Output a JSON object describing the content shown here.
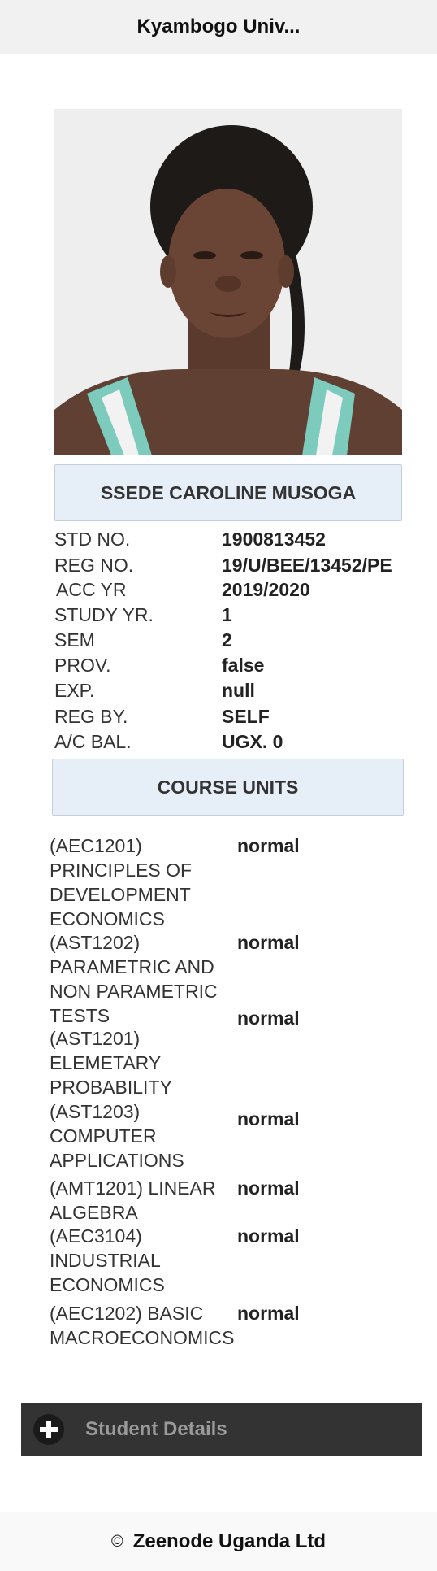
{
  "header": {
    "title": "Kyambogo Univ..."
  },
  "student": {
    "name": "SSEDE CAROLINE MUSOGA",
    "fields": [
      {
        "label": "STD NO.",
        "value": "1900813452"
      },
      {
        "label": "REG NO.",
        "value": "19/U/BEE/13452/PE"
      },
      {
        "label": "ACC YR",
        "value": "2019/2020"
      },
      {
        "label": "STUDY YR.",
        "value": "1"
      },
      {
        "label": "SEM",
        "value": "2"
      },
      {
        "label": "PROV.",
        "value": "false"
      },
      {
        "label": "EXP.",
        "value": "null"
      },
      {
        "label": "REG BY.",
        "value": "SELF"
      },
      {
        "label": "A/C BAL.",
        "value": "UGX. 0"
      }
    ]
  },
  "course_units": {
    "heading": "COURSE UNITS",
    "items": [
      {
        "name_lines": [
          "(AEC1201)",
          "PRINCIPLES OF",
          "DEVELOPMENT",
          "ECONOMICS"
        ],
        "status": "normal"
      },
      {
        "name_lines": [
          "(AST1202)",
          "PARAMETRIC AND",
          "NON PARAMETRIC",
          "TESTS"
        ],
        "status": "normal"
      },
      {
        "name_lines": [
          "(AST1201)",
          "ELEMETARY",
          "PROBABILITY"
        ],
        "status": "normal"
      },
      {
        "name_lines": [
          "(AST1203)",
          "COMPUTER",
          "APPLICATIONS"
        ],
        "status": "normal"
      },
      {
        "name_lines": [
          "(AMT1201) LINEAR",
          "ALGEBRA"
        ],
        "status": "normal"
      },
      {
        "name_lines": [
          "(AEC3104)",
          "INDUSTRIAL",
          "ECONOMICS"
        ],
        "status": "normal"
      },
      {
        "name_lines": [
          "(AEC1202) BASIC",
          "MACROECONOMICS"
        ],
        "status": "normal"
      }
    ]
  },
  "student_details": {
    "label": "Student Details",
    "icon": "plus-icon"
  },
  "footer": {
    "copyright_symbol": "©",
    "text": "Zeenode Uganda Ltd"
  }
}
